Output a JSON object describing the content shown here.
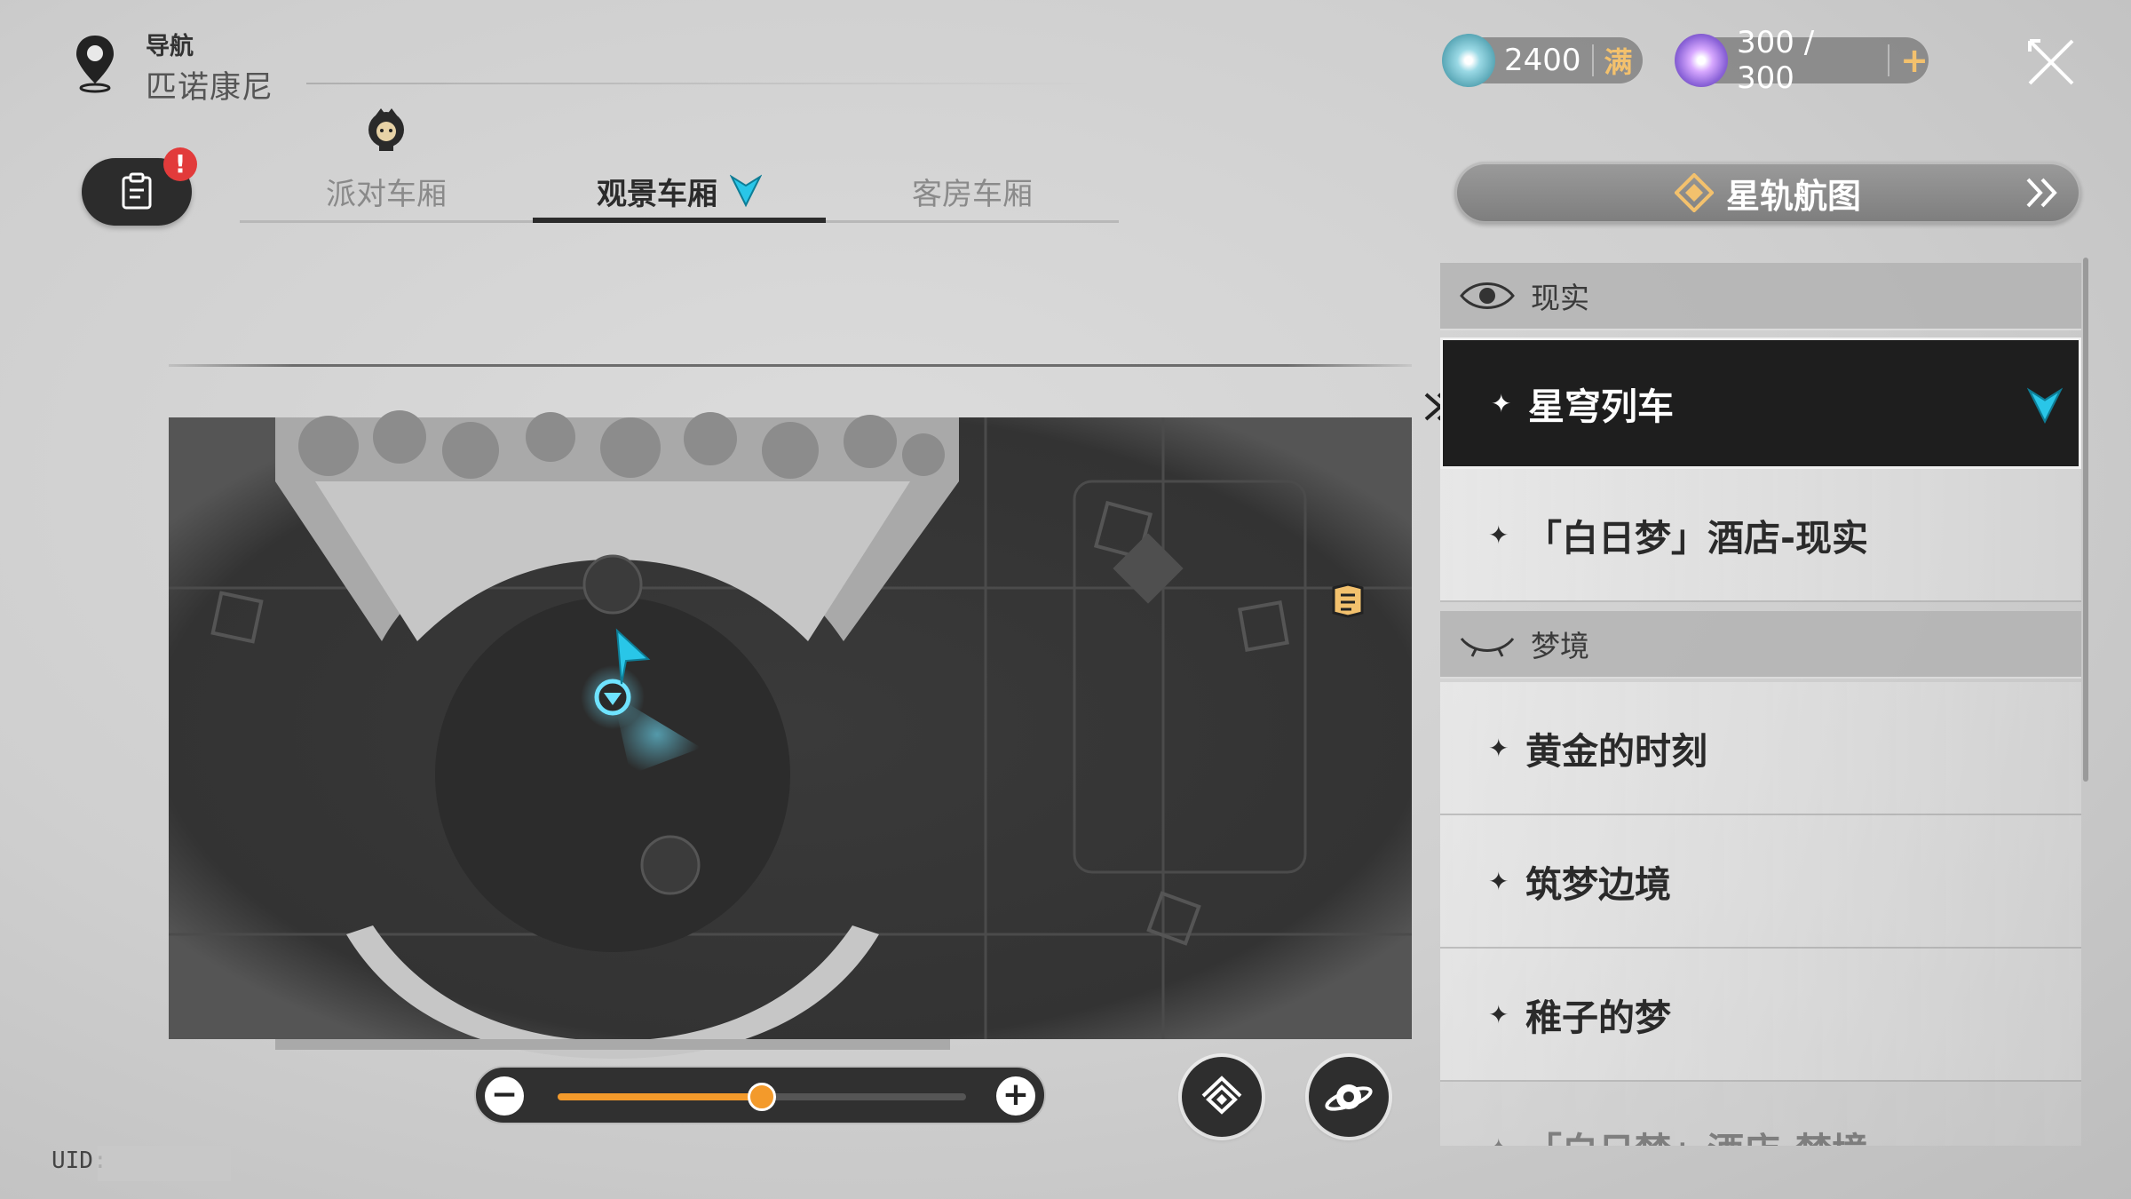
{
  "navigation": {
    "label": "导航",
    "location": "匹诺康尼"
  },
  "mission_button": {
    "icon": "clipboard-icon",
    "badge": "!"
  },
  "tabs": [
    {
      "label": "派对车厢",
      "active": false
    },
    {
      "label": "观景车厢",
      "active": true
    },
    {
      "label": "客房车厢",
      "active": false
    }
  ],
  "currencies": [
    {
      "icon": "trailblaze-fuel-icon",
      "value": "2400",
      "tag": "满"
    },
    {
      "icon": "trailblaze-power-icon",
      "value": "300 / 300",
      "tag": "+"
    }
  ],
  "starmap_button": {
    "label": "星轨航图"
  },
  "list": {
    "groups": [
      {
        "header": "现实",
        "icon": "eye-icon",
        "items": [
          {
            "label": "星穹列车",
            "selected": true
          },
          {
            "label": "「白日梦」酒店-现实",
            "selected": false
          }
        ]
      },
      {
        "header": "梦境",
        "icon": "closed-eye-icon",
        "items": [
          {
            "label": "黄金的时刻",
            "selected": false
          },
          {
            "label": "筑梦边境",
            "selected": false
          },
          {
            "label": "稚子的梦",
            "selected": false
          },
          {
            "label": "「白日梦」酒店-梦境",
            "selected": false
          }
        ]
      }
    ]
  },
  "zoom": {
    "minus": "−",
    "plus": "+",
    "level": 0.5
  },
  "uid": {
    "label": "UID:"
  },
  "colors": {
    "accent_cyan": "#29c6e8",
    "zoom_orange": "#f39a2b",
    "badge_red": "#e23b3b"
  }
}
